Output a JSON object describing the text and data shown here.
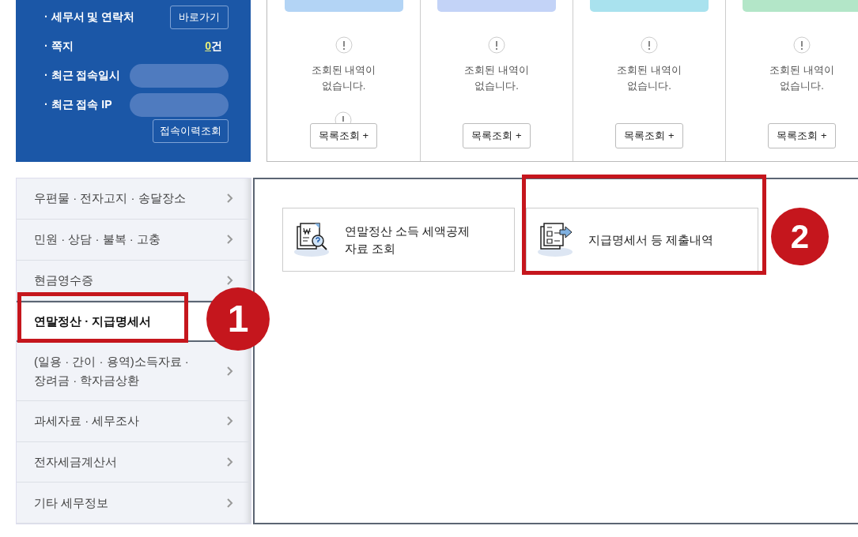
{
  "info_panel": {
    "rows": [
      {
        "kind": "button",
        "label": "· 세무서 및 연락처",
        "action": "바로가기"
      },
      {
        "kind": "count",
        "label": "· 쪽지",
        "count": "0",
        "unit": "건"
      },
      {
        "kind": "hidden",
        "label": "· 최근 접속일시"
      },
      {
        "kind": "hidden",
        "label": "· 최근 접속 IP"
      }
    ],
    "history_button": "접속이력조회"
  },
  "status_cards": [
    {
      "color": "#b3d4f5",
      "empty_text": "조회된 내역이\n없습니다.",
      "button": "목록조회 +",
      "glitch": true
    },
    {
      "color": "#c3d3f7",
      "empty_text": "조회된 내역이\n없습니다.",
      "button": "목록조회 +",
      "glitch": false
    },
    {
      "color": "#a9e2ee",
      "empty_text": "조회된 내역이\n없습니다.",
      "button": "목록조회 +",
      "glitch": false
    },
    {
      "color": "#b3e6c8",
      "empty_text": "조회된 내역이\n없습니다.",
      "button": "목록조회 +",
      "glitch": false
    }
  ],
  "sidebar": {
    "items": [
      {
        "label": "우편물 · 전자고지 · 송달장소",
        "selected": false
      },
      {
        "label": "민원 · 상담 · 불복 · 고충",
        "selected": false
      },
      {
        "label": "현금영수증",
        "selected": false
      },
      {
        "label": "연말정산 · 지급명세서",
        "selected": true
      },
      {
        "label": "(일용 · 간이 · 용역)소득자료 ·\n장려금 · 학자금상환",
        "selected": false
      },
      {
        "label": "과세자료 · 세무조사",
        "selected": false
      },
      {
        "label": "전자세금계산서",
        "selected": false
      },
      {
        "label": "기타 세무정보",
        "selected": false
      }
    ]
  },
  "content": {
    "tiles": [
      {
        "kind": "search-doc",
        "label": "연말정산 소득 세액공제\n자료 조회"
      },
      {
        "kind": "submit-doc",
        "label": "지급명세서 등 제출내역"
      }
    ]
  },
  "annotations": [
    {
      "number": "1",
      "kind": "sidebar"
    },
    {
      "number": "2",
      "kind": "tile"
    }
  ]
}
